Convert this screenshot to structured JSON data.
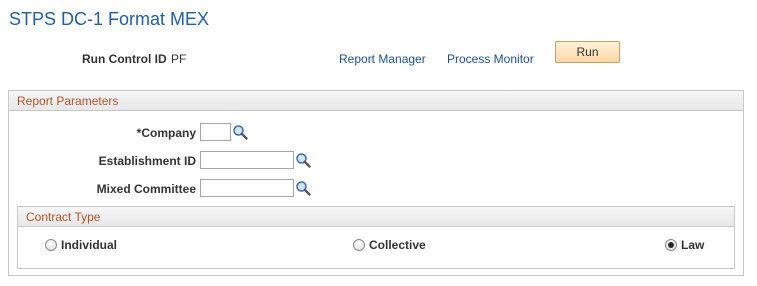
{
  "page": {
    "title": "STPS DC-1 Format MEX"
  },
  "run_control": {
    "label": "Run Control ID",
    "value": "PF"
  },
  "links": {
    "report_manager": "Report Manager",
    "process_monitor": "Process Monitor"
  },
  "buttons": {
    "run": "Run"
  },
  "report_parameters": {
    "header": "Report Parameters",
    "fields": {
      "company": {
        "label": "*Company",
        "value": ""
      },
      "establishment": {
        "label": "Establishment ID",
        "value": ""
      },
      "mixed_committee": {
        "label": "Mixed Committee",
        "value": ""
      }
    },
    "contract_type": {
      "header": "Contract Type",
      "options": [
        {
          "label": "Individual",
          "checked": false
        },
        {
          "label": "Collective",
          "checked": false
        },
        {
          "label": "Law",
          "checked": true
        }
      ]
    }
  },
  "colors": {
    "title": "#1e5eac",
    "link": "#1a4f95",
    "group_header_text": "#b0542a",
    "run_button": "#fbd8a5"
  },
  "icons": {
    "lookup": "magnifier-icon"
  }
}
